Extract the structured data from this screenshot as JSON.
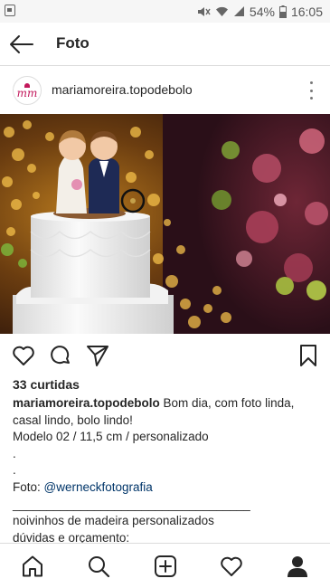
{
  "status_bar": {
    "battery_percent": "54%",
    "time": "16:05"
  },
  "app_bar": {
    "title": "Foto"
  },
  "post": {
    "username": "mariamoreira.topodebolo",
    "avatar_text": "mm",
    "likes": "33 curtidas",
    "caption": {
      "username": "mariamoreira.topodebolo",
      "line1_rest": " Bom dia, com foto linda,",
      "line2": "casal lindo, bolo lindo!",
      "line3": "Modelo 02 / 11,5 cm / personalizado",
      "line4": ".",
      "line5": ".",
      "line6_prefix": "Foto: ",
      "line6_link": "@werneckfotografia",
      "line7": "___________________________________",
      "line8": "noivinhos de madeira personalizados",
      "line9": "dúvidas e orçamento:"
    }
  },
  "icons": {
    "back": "arrow-left-icon",
    "more": "more-vertical-icon",
    "like": "heart-icon",
    "comment": "comment-icon",
    "share": "send-icon",
    "save": "bookmark-icon",
    "home": "home-icon",
    "search": "search-icon",
    "add": "add-post-icon",
    "activity": "heart-icon",
    "profile": "profile-icon"
  },
  "colors": {
    "text": "#262626",
    "link": "#003569",
    "divider": "#dbdbdb",
    "brand_avatar": "#c2185b"
  }
}
